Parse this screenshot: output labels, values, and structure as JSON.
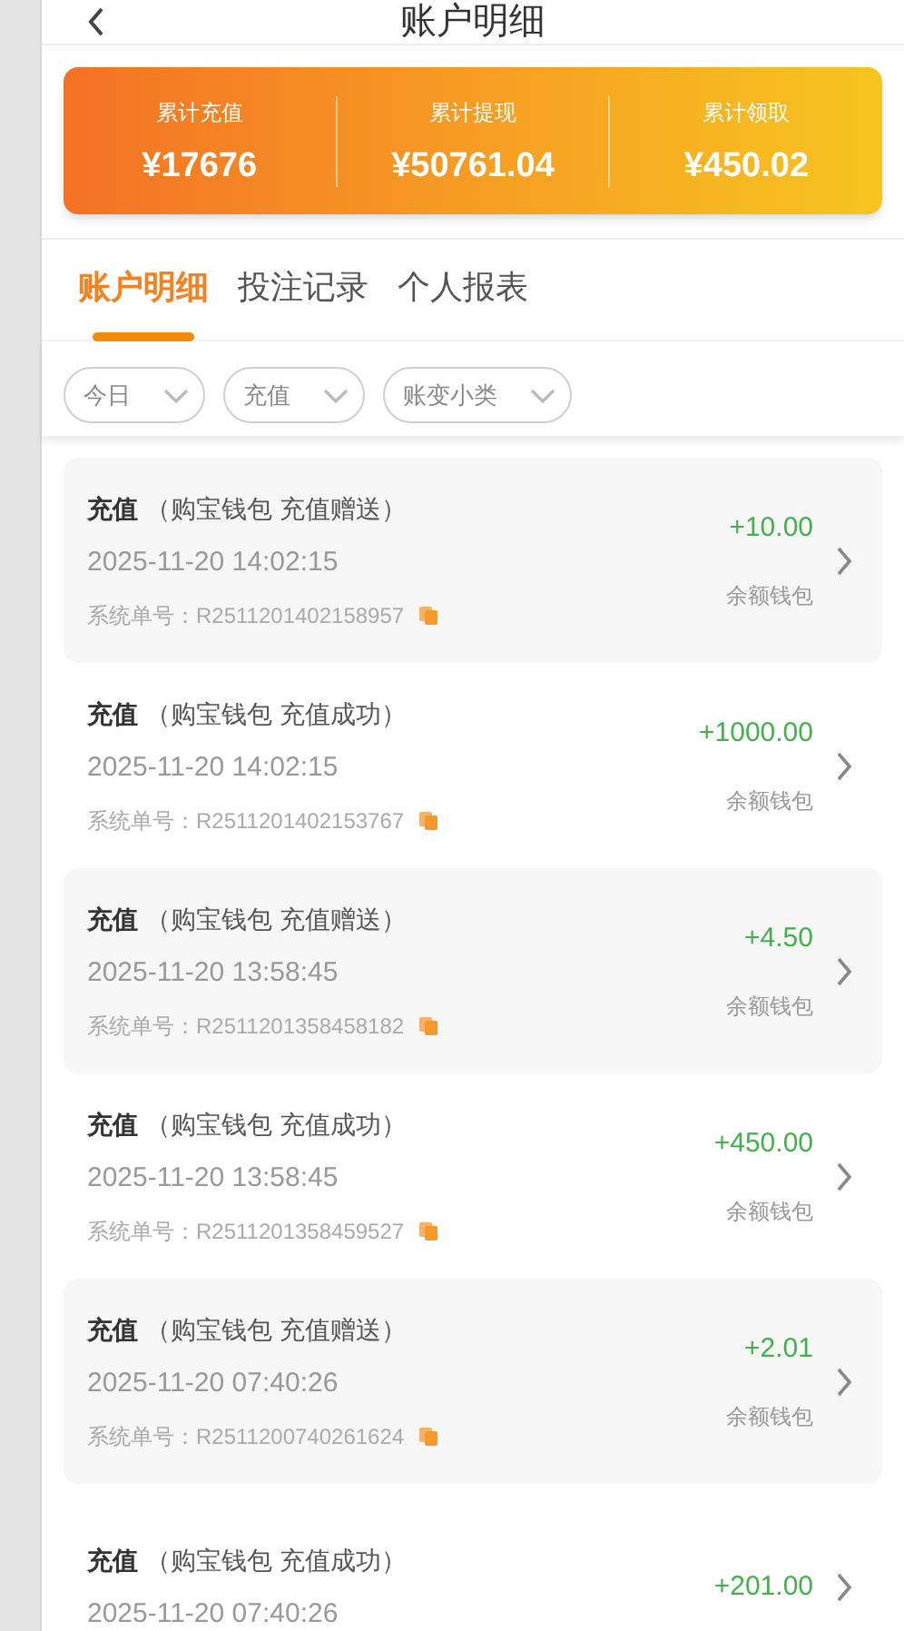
{
  "header": {
    "title": "账户明细"
  },
  "summary": [
    {
      "label": "累计充值",
      "value": "¥17676"
    },
    {
      "label": "累计提现",
      "value": "¥50761.04"
    },
    {
      "label": "累计领取",
      "value": "¥450.02"
    }
  ],
  "tabs": [
    {
      "label": "账户明细",
      "selected": true
    },
    {
      "label": "投注记录",
      "selected": false
    },
    {
      "label": "个人报表",
      "selected": false
    }
  ],
  "filters": [
    {
      "label": "今日"
    },
    {
      "label": "充值"
    },
    {
      "label": "账变小类"
    }
  ],
  "records": [
    {
      "type": "充值",
      "detail": "（购宝钱包 充值赠送）",
      "time": "2025-11-20 14:02:15",
      "order": "系统单号：R2511201402158957",
      "amount": "+10.00",
      "wallet": "余额钱包"
    },
    {
      "type": "充值",
      "detail": "（购宝钱包 充值成功）",
      "time": "2025-11-20 14:02:15",
      "order": "系统单号：R2511201402153767",
      "amount": "+1000.00",
      "wallet": "余额钱包"
    },
    {
      "type": "充值",
      "detail": "（购宝钱包 充值赠送）",
      "time": "2025-11-20 13:58:45",
      "order": "系统单号：R2511201358458182",
      "amount": "+4.50",
      "wallet": "余额钱包"
    },
    {
      "type": "充值",
      "detail": "（购宝钱包 充值成功）",
      "time": "2025-11-20 13:58:45",
      "order": "系统单号：R2511201358459527",
      "amount": "+450.00",
      "wallet": "余额钱包"
    },
    {
      "type": "充值",
      "detail": "（购宝钱包 充值赠送）",
      "time": "2025-11-20 07:40:26",
      "order": "系统单号：R2511200740261624",
      "amount": "+2.01",
      "wallet": "余额钱包"
    },
    {
      "type": "充值",
      "detail": "（购宝钱包 充值成功）",
      "time": "2025-11-20 07:40:26",
      "amount": "+201.00"
    }
  ]
}
